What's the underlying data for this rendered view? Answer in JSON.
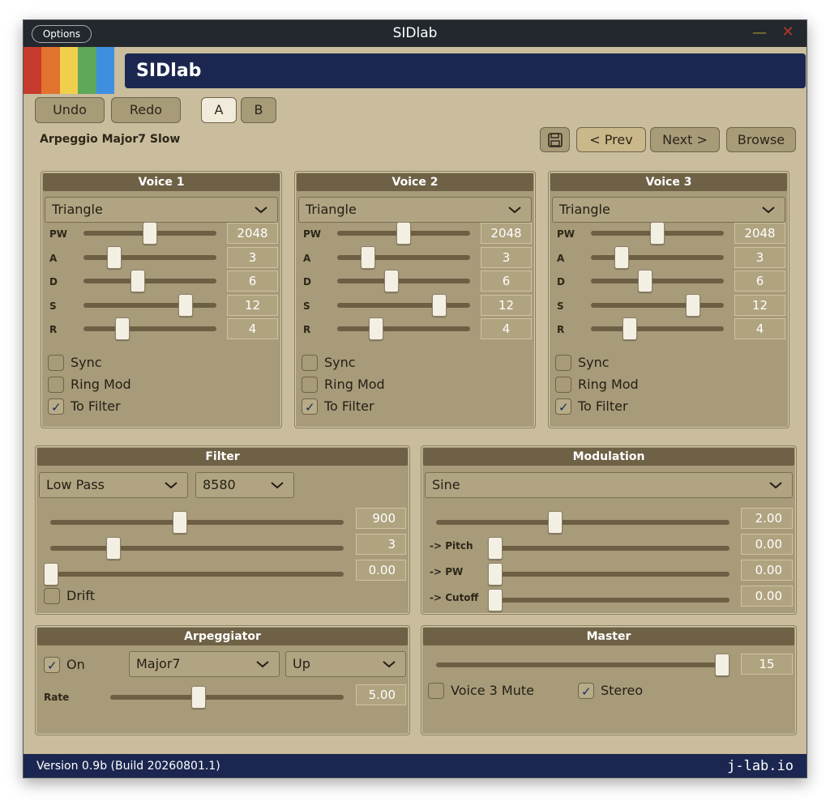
{
  "window": {
    "title": "SIDlab",
    "options_label": "Options",
    "minimize_icon": "minimize-icon",
    "close_icon": "close-icon"
  },
  "header": {
    "title": "SIDlab",
    "rainbow_colors": [
      "#c73a2e",
      "#e2732e",
      "#f1cf4c",
      "#5ea85a",
      "#3f8fe0"
    ]
  },
  "toolbar": {
    "undo_label": "Undo",
    "redo_label": "Redo",
    "a_label": "A",
    "b_label": "B"
  },
  "preset": {
    "name": "Arpeggio Major7 Slow",
    "save_icon": "save-icon",
    "prev_label": "< Prev",
    "next_label": "Next >",
    "browse_label": "Browse"
  },
  "voices": [
    {
      "title": "Voice 1",
      "waveform": "Triangle",
      "params": [
        {
          "label": "PW",
          "value": "2048",
          "level": 0.5
        },
        {
          "label": "A",
          "value": "3",
          "level": 0.2
        },
        {
          "label": "D",
          "value": "6",
          "level": 0.4
        },
        {
          "label": "S",
          "value": "12",
          "level": 0.8
        },
        {
          "label": "R",
          "value": "4",
          "level": 0.27
        }
      ],
      "sync_label": "Sync",
      "sync": false,
      "ringmod_label": "Ring Mod",
      "ringmod": false,
      "tofilter_label": "To Filter",
      "tofilter": true
    },
    {
      "title": "Voice 2",
      "waveform": "Triangle",
      "params": [
        {
          "label": "PW",
          "value": "2048",
          "level": 0.5
        },
        {
          "label": "A",
          "value": "3",
          "level": 0.2
        },
        {
          "label": "D",
          "value": "6",
          "level": 0.4
        },
        {
          "label": "S",
          "value": "12",
          "level": 0.8
        },
        {
          "label": "R",
          "value": "4",
          "level": 0.27
        }
      ],
      "sync_label": "Sync",
      "sync": false,
      "ringmod_label": "Ring Mod",
      "ringmod": false,
      "tofilter_label": "To Filter",
      "tofilter": true
    },
    {
      "title": "Voice 3",
      "waveform": "Triangle",
      "params": [
        {
          "label": "PW",
          "value": "2048",
          "level": 0.5
        },
        {
          "label": "A",
          "value": "3",
          "level": 0.2
        },
        {
          "label": "D",
          "value": "6",
          "level": 0.4
        },
        {
          "label": "S",
          "value": "12",
          "level": 0.8
        },
        {
          "label": "R",
          "value": "4",
          "level": 0.27
        }
      ],
      "sync_label": "Sync",
      "sync": false,
      "ringmod_label": "Ring Mod",
      "ringmod": false,
      "tofilter_label": "To Filter",
      "tofilter": true
    }
  ],
  "filter": {
    "title": "Filter",
    "type": "Low Pass",
    "chip": "8580",
    "cutoff": {
      "value": "900",
      "level": 0.44
    },
    "resonance": {
      "value": "3",
      "level": 0.2
    },
    "third": {
      "value": "0.00",
      "level": 0.0
    },
    "drift_label": "Drift",
    "drift": false
  },
  "modulation": {
    "title": "Modulation",
    "shape": "Sine",
    "rate": {
      "value": "2.00",
      "level": 0.4
    },
    "pitch": {
      "label": "-> Pitch",
      "value": "0.00",
      "level": 0.0
    },
    "pw": {
      "label": "-> PW",
      "value": "0.00",
      "level": 0.0
    },
    "cutoff": {
      "label": "-> Cutoff",
      "value": "0.00",
      "level": 0.0
    }
  },
  "arpeggiator": {
    "title": "Arpeggiator",
    "on_label": "On",
    "on": true,
    "chord": "Major7",
    "direction": "Up",
    "rate_label": "Rate",
    "rate": {
      "value": "5.00",
      "level": 0.37
    }
  },
  "master": {
    "title": "Master",
    "volume": {
      "value": "15",
      "level": 1.0
    },
    "mute_label": "Voice 3 Mute",
    "mute": false,
    "stereo_label": "Stereo",
    "stereo": true
  },
  "footer": {
    "version": "Version 0.9b (Build 20260801.1)",
    "brand": "j-lab.io"
  }
}
